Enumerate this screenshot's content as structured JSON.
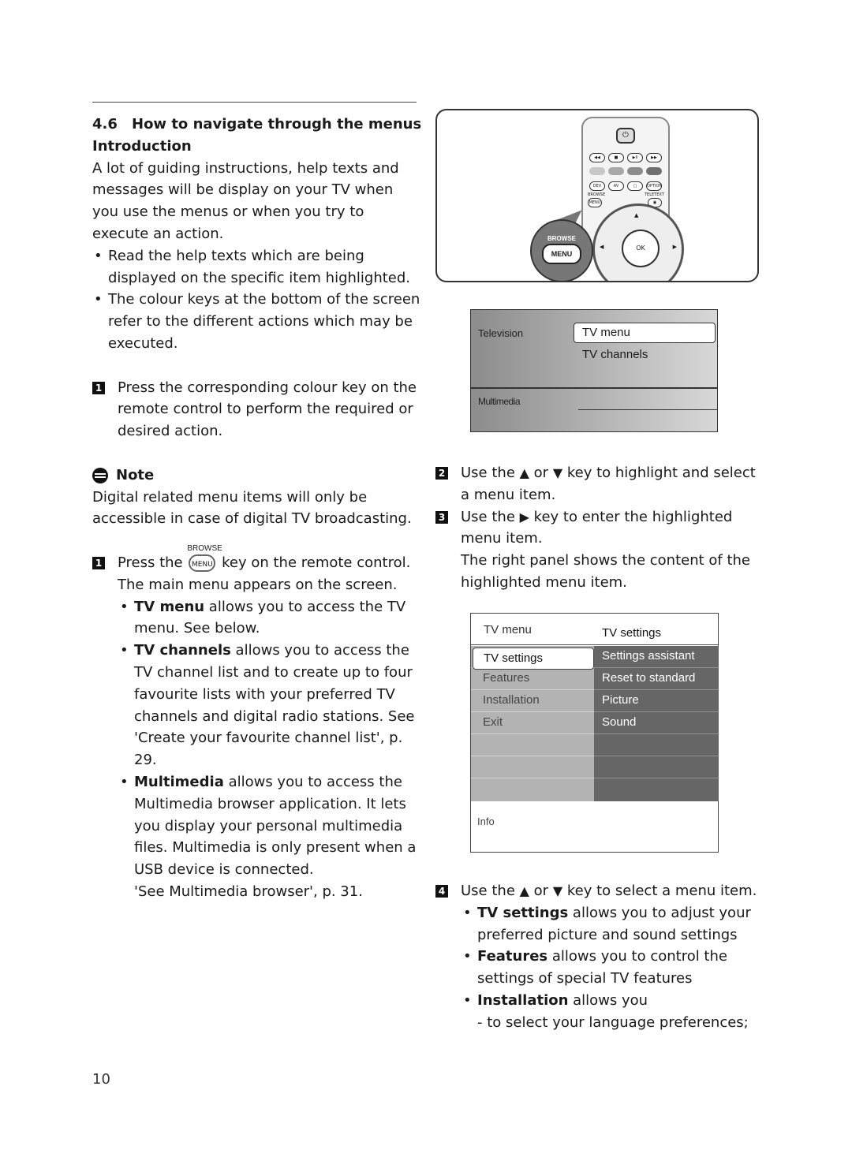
{
  "section": {
    "number": "4.6",
    "title": "How to navigate through the menus",
    "subtitle": "Introduction",
    "intro": "A lot of guiding instructions, help texts and messages will be display on your TV when you use the menus or when you try to execute an action.",
    "bullets": [
      "Read the help texts which are being displayed on the specific item highlighted.",
      "The colour keys at the bottom of the screen refer to the different actions which may be executed."
    ],
    "step_colour": {
      "num": "1",
      "text": "Press the corresponding colour key on the remote control to perform the required or desired action."
    }
  },
  "note": {
    "title": "Note",
    "text": "Digital related menu items will only be accessible in case of digital TV broadcasting."
  },
  "step1": {
    "num": "1",
    "pre": "Press the",
    "key_label": "MENU",
    "key_above": "BROWSE",
    "post": "key on the remote control.",
    "line2": "The main menu appears on the screen.",
    "bullets": [
      {
        "bold": "TV menu",
        "text": " allows you to access the TV menu. See below."
      },
      {
        "bold": "TV channels",
        "text": " allows you to access the TV channel list and to create up to four favourite lists with your preferred TV channels and digital radio stations. See 'Create your favourite channel list', p. 29."
      },
      {
        "bold": "Multimedia",
        "text": " allows you to access the Multimedia browser application. It lets you display your personal multimedia files. Multimedia is only present when a USB device is connected."
      }
    ],
    "see_also": "'See Multimedia browser', p. 31."
  },
  "remote": {
    "transport": [
      "◀◀",
      "■",
      "▶II",
      "▶▶"
    ],
    "colour_keys": [
      "#c8c8c8",
      "#a8a8a8",
      "#8c8c8c",
      "#707070"
    ],
    "row3": [
      "DEV",
      "AV",
      "□",
      "OPTION"
    ],
    "browse": "BROWSE",
    "menu": "MENU",
    "teletext": "TELETEXT",
    "ok": "OK",
    "callout_browse": "BROWSE",
    "callout_menu": "MENU"
  },
  "tv_main_menu": {
    "television": "Television",
    "selected": "TV menu",
    "item2": "TV channels",
    "multimedia": "Multimedia"
  },
  "step2": {
    "num": "2",
    "pre": "Use the",
    "up": "▲",
    "or": "or",
    "down": "▼",
    "post": "key to highlight and select a menu item."
  },
  "step3": {
    "num": "3",
    "pre": "Use the",
    "right": "▶",
    "post": "key to enter the highlighted menu item.",
    "extra": "The right panel shows the content of the highlighted menu item."
  },
  "tv_settings_menu": {
    "header_left": "TV menu",
    "header_right": "TV settings",
    "left_items": [
      "TV settings",
      "Features",
      "Installation",
      "Exit",
      "",
      "",
      ""
    ],
    "right_items": [
      "Settings assistant",
      "Reset to standard",
      "Picture",
      "Sound",
      "",
      "",
      ""
    ],
    "info": "Info"
  },
  "step4": {
    "num": "4",
    "pre": "Use the",
    "up": "▲",
    "or": "or",
    "down": "▼",
    "post": "key to select a menu item.",
    "bullets": [
      {
        "bold": "TV settings",
        "text": " allows you to adjust your preferred picture and sound settings"
      },
      {
        "bold": "Features",
        "text": " allows you to control the settings of special TV features"
      },
      {
        "bold": "Installation",
        "text": " allows you"
      }
    ],
    "sub": "- to select your language preferences;"
  },
  "page_number": "10"
}
